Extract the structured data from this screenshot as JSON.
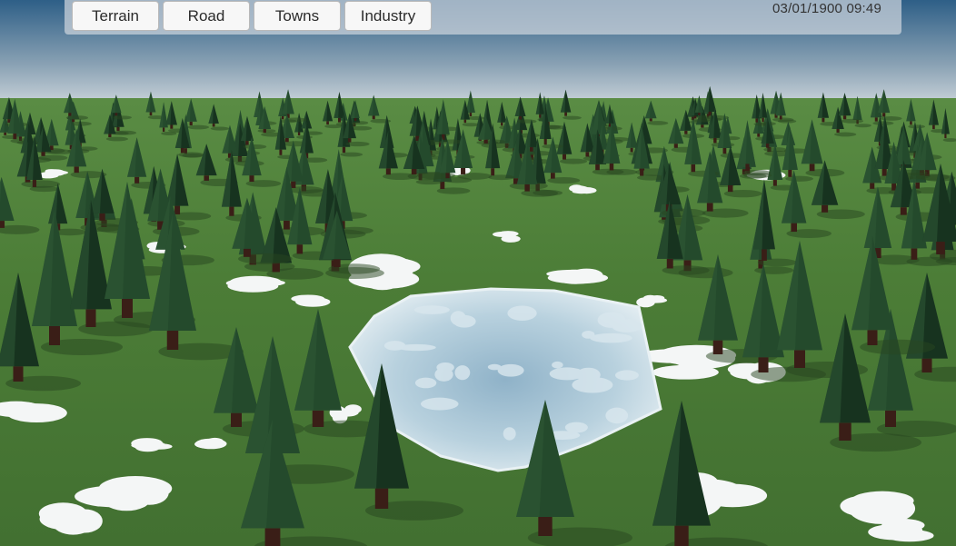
{
  "toolbar": {
    "buttons": [
      {
        "label": "Terrain"
      },
      {
        "label": "Road"
      },
      {
        "label": "Towns"
      },
      {
        "label": "Industry"
      }
    ],
    "datetime": "03/01/1900 09:49"
  },
  "scene": {
    "colors": {
      "sky_top": "#2e5f87",
      "sky_horizon": "#dfe3e6",
      "grass": "#4a7a35",
      "grass_light": "#5e9144",
      "snow": "#f4f6f6",
      "ice": "#b9d2de",
      "tree_dark": "#17331f",
      "tree_mid": "#244a2c",
      "trunk": "#3a1e17"
    }
  }
}
